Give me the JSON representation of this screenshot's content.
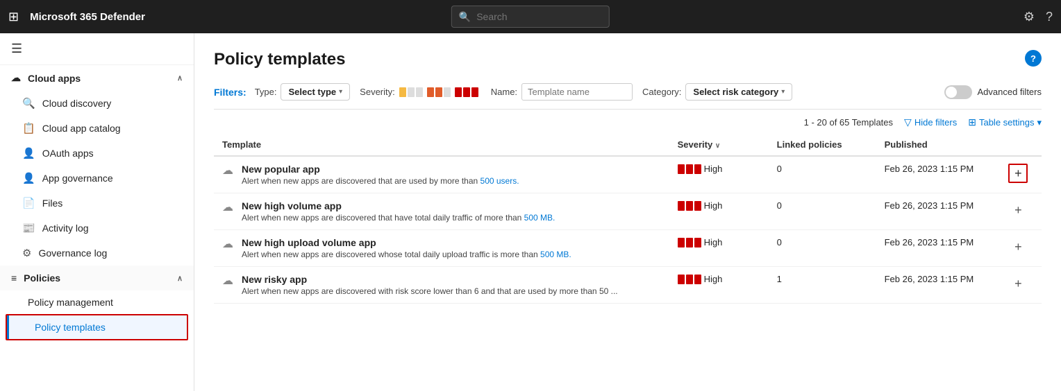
{
  "app": {
    "title": "Microsoft 365 Defender",
    "search_placeholder": "Search"
  },
  "sidebar": {
    "hamburger_label": "☰",
    "cloud_apps_label": "Cloud apps",
    "items": [
      {
        "id": "cloud-discovery",
        "label": "Cloud discovery",
        "icon": "🔍"
      },
      {
        "id": "cloud-app-catalog",
        "label": "Cloud app catalog",
        "icon": "📋"
      },
      {
        "id": "oauth-apps",
        "label": "OAuth apps",
        "icon": "👤"
      },
      {
        "id": "app-governance",
        "label": "App governance",
        "icon": "👤"
      },
      {
        "id": "files",
        "label": "Files",
        "icon": "📄"
      },
      {
        "id": "activity-log",
        "label": "Activity log",
        "icon": "📰"
      },
      {
        "id": "governance-log",
        "label": "Governance log",
        "icon": "⚙"
      }
    ],
    "policies_label": "Policies",
    "policy_items": [
      {
        "id": "policy-management",
        "label": "Policy management"
      },
      {
        "id": "policy-templates",
        "label": "Policy templates",
        "active": true
      }
    ]
  },
  "content": {
    "page_title": "Policy templates",
    "filters_label": "Filters:",
    "type_label": "Type:",
    "type_value": "Select type",
    "severity_label": "Severity:",
    "name_label": "Name:",
    "name_placeholder": "Template name",
    "category_label": "Category:",
    "category_value": "Select risk category",
    "advanced_filters_label": "Advanced filters",
    "table_count": "1 - 20 of 65 Templates",
    "hide_filters_label": "Hide filters",
    "table_settings_label": "Table settings",
    "columns": [
      {
        "id": "template",
        "label": "Template"
      },
      {
        "id": "severity",
        "label": "Severity",
        "sortable": true
      },
      {
        "id": "linked",
        "label": "Linked policies"
      },
      {
        "id": "published",
        "label": "Published"
      }
    ],
    "rows": [
      {
        "name": "New popular app",
        "description": "Alert when new apps are discovered that are used by more than ",
        "description_link": "500 users.",
        "severity": "High",
        "linked": "0",
        "published": "Feb 26, 2023 1:15 PM",
        "add_highlighted": true
      },
      {
        "name": "New high volume app",
        "description": "Alert when new apps are discovered that have total daily traffic of more than ",
        "description_link": "500 MB.",
        "severity": "High",
        "linked": "0",
        "published": "Feb 26, 2023 1:15 PM",
        "add_highlighted": false
      },
      {
        "name": "New high upload volume app",
        "description": "Alert when new apps are discovered whose total daily upload traffic is more than ",
        "description_link": "500 MB.",
        "severity": "High",
        "linked": "0",
        "published": "Feb 26, 2023 1:15 PM",
        "add_highlighted": false
      },
      {
        "name": "New risky app",
        "description": "Alert when new apps are discovered with risk score lower than 6 and that are used by more than 50 ...",
        "description_link": "",
        "severity": "High",
        "linked": "1",
        "published": "Feb 26, 2023 1:15 PM",
        "add_highlighted": false
      }
    ]
  }
}
